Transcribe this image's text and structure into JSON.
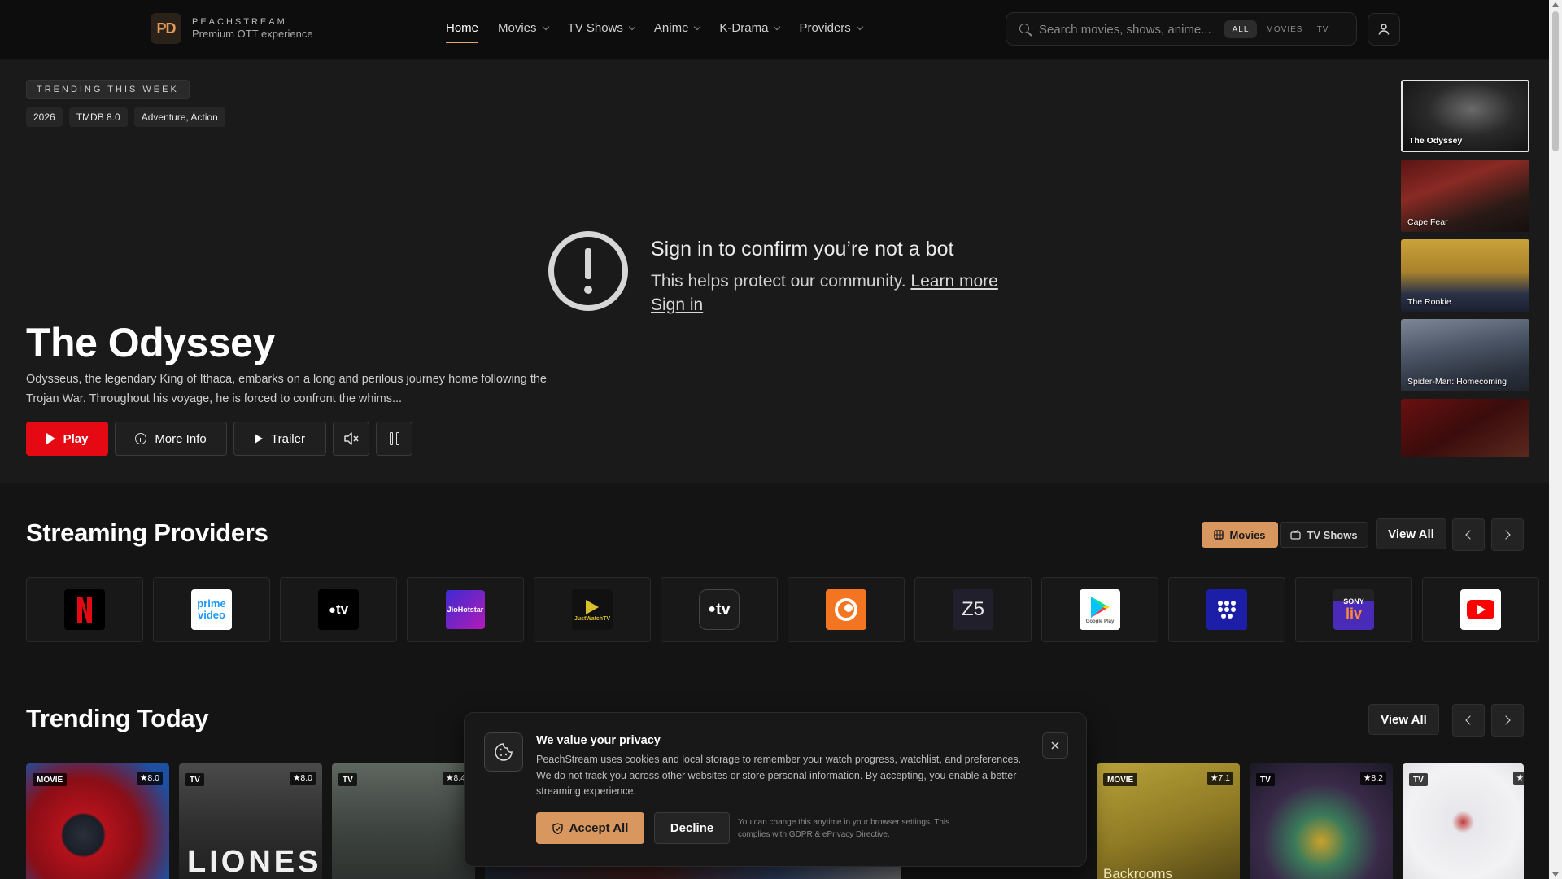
{
  "brand": {
    "logo_text": "PD",
    "name": "PEACHSTREAM",
    "tagline": "Premium OTT experience"
  },
  "nav": [
    {
      "label": "Home",
      "active": true
    },
    {
      "label": "Movies"
    },
    {
      "label": "TV Shows"
    },
    {
      "label": "Anime"
    },
    {
      "label": "K-Drama"
    },
    {
      "label": "Providers"
    }
  ],
  "search": {
    "placeholder": "Search movies, shows, anime...",
    "filters": [
      "ALL",
      "MOVIES",
      "TV"
    ],
    "selected": "ALL"
  },
  "hero": {
    "badge": "TRENDING THIS WEEK",
    "year": "2026",
    "rating": "TMDB 8.0",
    "genres": "Adventure, Action",
    "title": "The Odyssey",
    "description": "Odysseus, the legendary King of Ithaca, embarks on a long and perilous journey home following the Trojan War. Throughout his voyage, he is forced to confront the whims...",
    "buttons": {
      "play": "Play",
      "more_info": "More Info",
      "trailer": "Trailer"
    }
  },
  "bot_check": {
    "title": "Sign in to confirm you’re not a bot",
    "message": "This helps protect our community.",
    "learn_more": "Learn more",
    "sign_in": "Sign in"
  },
  "trending_thumbs": [
    {
      "title": "The Odyssey",
      "selected": true
    },
    {
      "title": "Cape Fear"
    },
    {
      "title": "The Rookie"
    },
    {
      "title": "Spider-Man: Homecoming"
    },
    {
      "title": ""
    }
  ],
  "providers": {
    "title": "Streaming Providers",
    "toggle": [
      "Movies",
      "TV Shows"
    ],
    "selected_toggle": "Movies",
    "view_all": "View All",
    "logos": [
      "netflix-logo",
      "prime-video-logo",
      "apple-tv-logo",
      "jiohotstar-logo",
      "justwatchtv-logo",
      "apple-tv-plus-logo",
      "crunchyroll-logo",
      "zee5-logo",
      "google-play-logo",
      "mubi-logo",
      "sony-liv-logo",
      "youtube-logo"
    ],
    "logo_text": {
      "prime": "prime video",
      "appletv": "tv",
      "jiohotstar": "JioHotstar",
      "justwatch": "JustWatchTV",
      "zee5": "Z5",
      "googleplay": "Google Play",
      "sony": "SONY",
      "sonyliv": "liv"
    }
  },
  "trending_today": {
    "title": "Trending Today",
    "view_all": "View All",
    "cards": [
      {
        "type": "MOVIE",
        "rating": "8.0"
      },
      {
        "type": "TV",
        "rating": "8.0",
        "art_text": "LIONESS"
      },
      {
        "type": "TV",
        "rating": "8.4"
      },
      {
        "type": "MOVIE",
        "rating": "7.1",
        "art_text": "Backrooms"
      },
      {
        "type": "TV",
        "rating": "8.2"
      },
      {
        "type": "TV",
        "rating": ""
      }
    ]
  },
  "cookie": {
    "title": "We value your privacy",
    "text": "PeachStream uses cookies and local storage to remember your watch progress, watchlist, and preferences. We do not track you across other websites or store personal information. By accepting, you enable a better streaming experience.",
    "accept": "Accept All",
    "decline": "Decline",
    "note": "You can change this anytime in your browser settings. This complies with GDPR & ePrivacy Directive."
  },
  "colors": {
    "accent": "#d99760",
    "play_red": "#e50914",
    "background": "#141414"
  }
}
